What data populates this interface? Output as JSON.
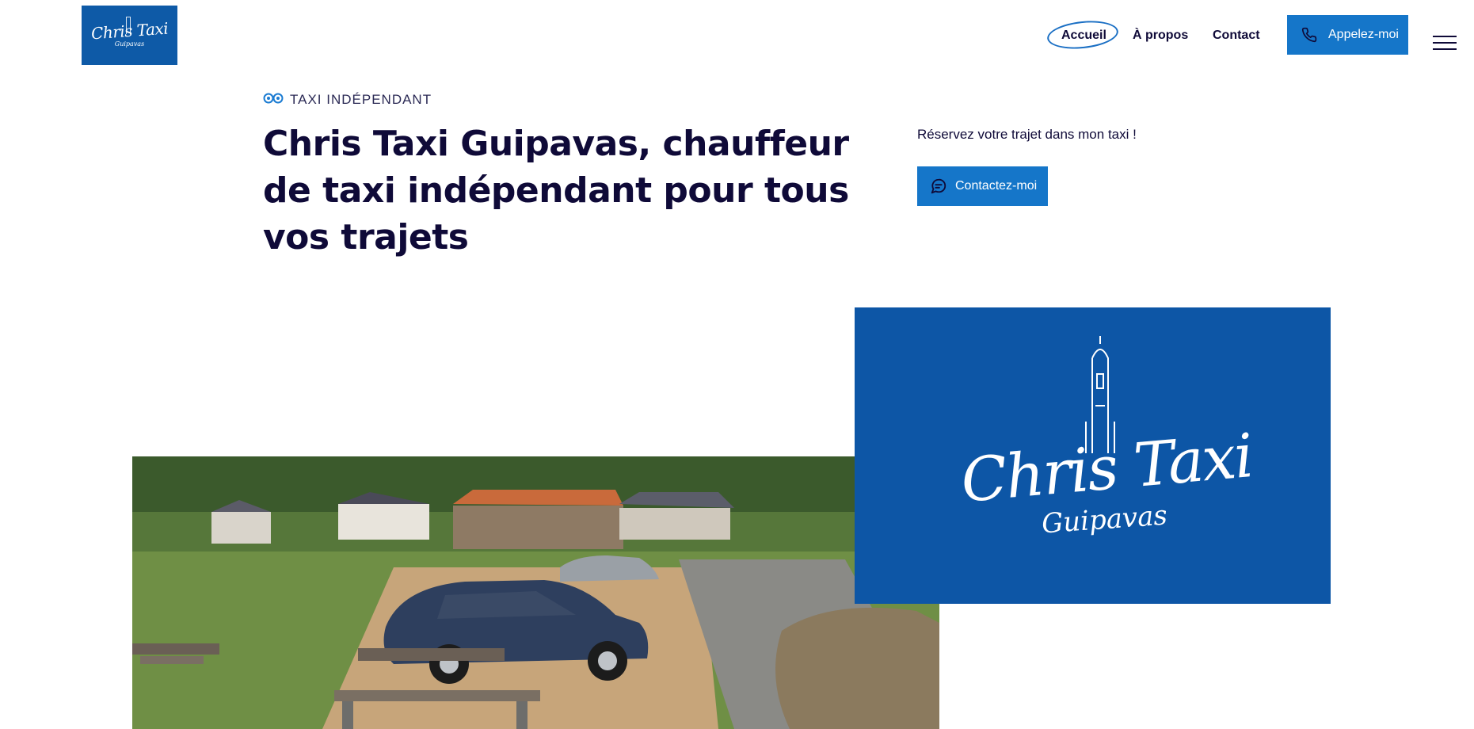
{
  "brand": {
    "logo_text": "Chris Taxi",
    "logo_subtext": "Guipavas"
  },
  "nav": {
    "items": [
      {
        "label": "Accueil",
        "active": true
      },
      {
        "label": "À propos",
        "active": false
      },
      {
        "label": "Contact",
        "active": false
      }
    ],
    "call_button": "Appelez-moi",
    "call_icon": "phone-icon",
    "menu_icon": "hamburger-menu-icon"
  },
  "hero": {
    "eyebrow": "TAXI INDÉPENDANT",
    "eyebrow_icon": "double-circle-icon",
    "title": "Chris Taxi Guipavas, chauffeur de taxi indépendant pour tous vos trajets",
    "side_text": "Réservez votre trajet dans mon taxi !",
    "contact_button": "Contactez-moi",
    "contact_icon": "chat-bubble-icon"
  },
  "colors": {
    "accent": "#1576c9",
    "brand_blue": "#0d56a6",
    "text_dark": "#0f0a38"
  }
}
